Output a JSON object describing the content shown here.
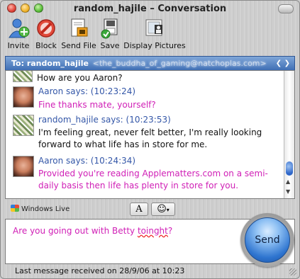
{
  "window": {
    "title": "random_hajile – Conversation"
  },
  "toolbar": {
    "invite": "Invite",
    "block": "Block",
    "send_file": "Send File",
    "save": "Save",
    "display_pictures": "Display Pictures"
  },
  "to_bar": {
    "label": "To: random_hajile",
    "email_blurred": "<the_buddha_of_gaming@natchoplas.com>",
    "arrows": "❮ ❯"
  },
  "conversation": [
    {
      "sender": "random_hajile",
      "header": "",
      "text": "How are you Aaron?"
    },
    {
      "sender": "Aaron",
      "header": "Aaron says: (10:23:24)",
      "text": "Fine thanks mate, yourself?"
    },
    {
      "sender": "random_hajile",
      "header": "random_hajile says: (10:23:53)",
      "text": "I'm feeling great, never felt better, I'm really looking forward to what life has in store for me."
    },
    {
      "sender": "Aaron",
      "header": "Aaron says: (10:24:34)",
      "text": "Provided you're reading Applematters.com on a semi-daily basis then life has plenty in store for you."
    }
  ],
  "branding": {
    "windows_live": "Windows Live"
  },
  "format": {
    "font_button": "A",
    "emoticon_button": "☺"
  },
  "compose": {
    "text_before": "Are you going out with Betty ",
    "misspelled": "toinght",
    "text_after": "?"
  },
  "send_button": "Send",
  "status": "Last message received on 28/9/06 at 10:23",
  "colors": {
    "accent": "#3457a8",
    "own_text": "#d01fb6",
    "to_bar": "#3f6fb5"
  },
  "icons": [
    "invite-icon",
    "block-icon",
    "send-file-icon",
    "save-icon",
    "display-pictures-icon"
  ]
}
